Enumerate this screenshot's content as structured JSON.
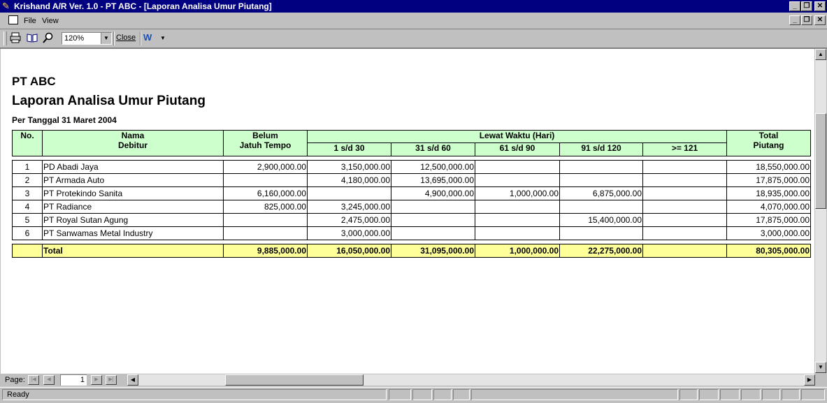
{
  "window": {
    "title": "Krishand A/R Ver. 1.0 - PT ABC - [Laporan Analisa Umur Piutang]",
    "min_label": "_",
    "restore_label": "❐",
    "close_label": "✕"
  },
  "menu": {
    "file": "File",
    "view": "View"
  },
  "toolbar": {
    "zoom_value": "120%",
    "close_label": "Close"
  },
  "report": {
    "company": "PT ABC",
    "title": "Laporan Analisa Umur Piutang",
    "date_line": "Per Tanggal 31 Maret 2004",
    "headers": {
      "no": "No.",
      "nama_line1": "Nama",
      "nama_line2": "Debitur",
      "belum_line1": "Belum",
      "belum_line2": "Jatuh Tempo",
      "lewat": "Lewat Waktu (Hari)",
      "b1": "1 s/d 30",
      "b2": "31 s/d 60",
      "b3": "61 s/d 90",
      "b4": "91 s/d 120",
      "b5": ">= 121",
      "total_line1": "Total",
      "total_line2": "Piutang"
    },
    "rows": [
      {
        "no": "1",
        "name": "PD Abadi Jaya",
        "belum": "2,900,000.00",
        "b1": "3,150,000.00",
        "b2": "12,500,000.00",
        "b3": "",
        "b4": "",
        "b5": "",
        "total": "18,550,000.00"
      },
      {
        "no": "2",
        "name": "PT Armada Auto",
        "belum": "",
        "b1": "4,180,000.00",
        "b2": "13,695,000.00",
        "b3": "",
        "b4": "",
        "b5": "",
        "total": "17,875,000.00"
      },
      {
        "no": "3",
        "name": "PT Protekindo Sanita",
        "belum": "6,160,000.00",
        "b1": "",
        "b2": "4,900,000.00",
        "b3": "1,000,000.00",
        "b4": "6,875,000.00",
        "b5": "",
        "total": "18,935,000.00"
      },
      {
        "no": "4",
        "name": "PT Radiance",
        "belum": "825,000.00",
        "b1": "3,245,000.00",
        "b2": "",
        "b3": "",
        "b4": "",
        "b5": "",
        "total": "4,070,000.00"
      },
      {
        "no": "5",
        "name": "PT Royal Sutan Agung",
        "belum": "",
        "b1": "2,475,000.00",
        "b2": "",
        "b3": "",
        "b4": "15,400,000.00",
        "b5": "",
        "total": "17,875,000.00"
      },
      {
        "no": "6",
        "name": "PT Sanwamas Metal Industry",
        "belum": "",
        "b1": "3,000,000.00",
        "b2": "",
        "b3": "",
        "b4": "",
        "b5": "",
        "total": "3,000,000.00"
      }
    ],
    "totals": {
      "label": "Total",
      "belum": "9,885,000.00",
      "b1": "16,050,000.00",
      "b2": "31,095,000.00",
      "b3": "1,000,000.00",
      "b4": "22,275,000.00",
      "b5": "",
      "total": "80,305,000.00"
    }
  },
  "pager": {
    "label": "Page:",
    "current": "1"
  },
  "status": {
    "text": "Ready"
  }
}
